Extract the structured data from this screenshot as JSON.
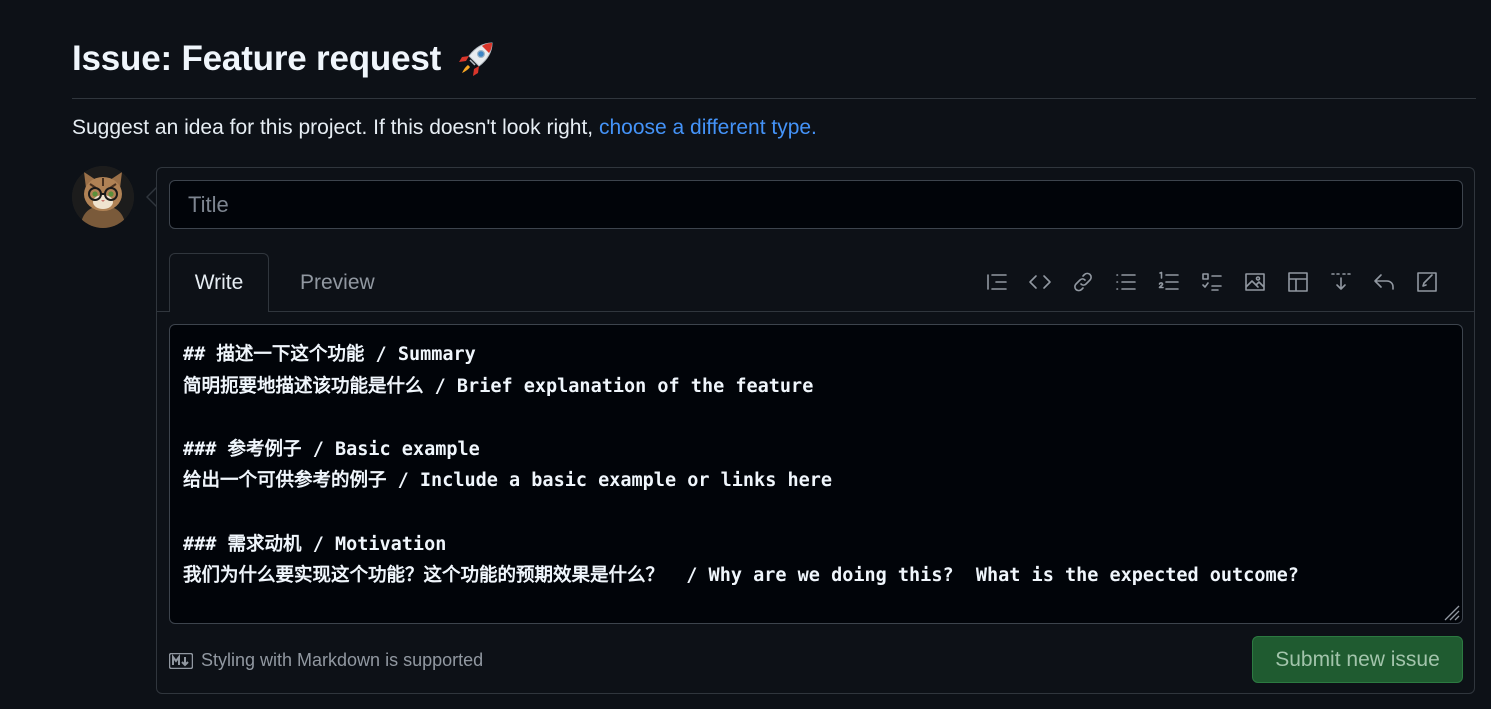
{
  "header": {
    "title": "Issue: Feature request",
    "title_icon": "rocket-icon",
    "subtitle_text": "Suggest an idea for this project. If this doesn't look right, ",
    "subtitle_link": "choose a different type."
  },
  "form": {
    "avatar_icon": "cat-avatar",
    "title_placeholder": "Title",
    "tabs": [
      {
        "label": "Write",
        "active": true
      },
      {
        "label": "Preview",
        "active": false
      }
    ],
    "toolbar_icons": [
      "heading-icon",
      "code-icon",
      "link-icon",
      "bulleted-list-icon",
      "numbered-list-icon",
      "task-list-icon",
      "image-icon",
      "table-icon",
      "collapsed-section-icon",
      "reply-icon",
      "edit-icon"
    ],
    "editor_lines": [
      "## 描述一下这个功能 / Summary",
      "简明扼要地描述该功能是什么 / Brief explanation of the feature",
      "",
      "### 参考例子 / Basic example",
      "给出一个可供参考的例子 / Include a basic example or links here",
      "",
      "### 需求动机 / Motivation",
      "我们为什么要实现这个功能？这个功能的预期效果是什么？  / Why are we doing this?  What is the expected outcome?"
    ],
    "markdown_note": "Styling with Markdown is supported",
    "markdown_icon": "markdown-icon",
    "submit_label": "Submit new issue"
  },
  "colors": {
    "background": "#0d1117",
    "link": "#4493f8",
    "submit_bg": "#1f5b30",
    "border": "#30363d"
  }
}
